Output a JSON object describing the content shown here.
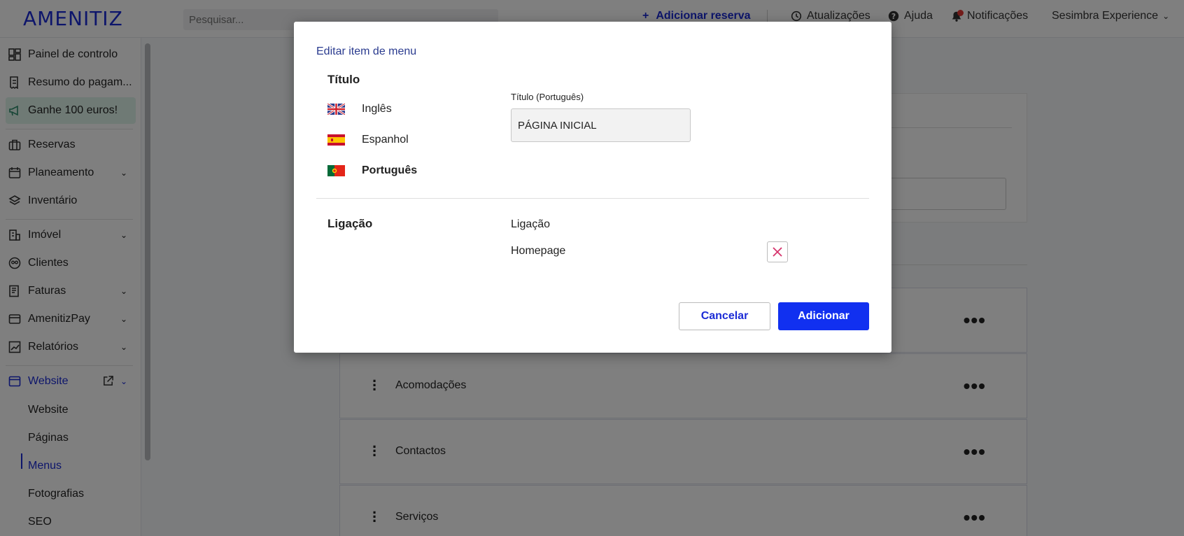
{
  "header": {
    "logo": "AMENITIZ",
    "search_placeholder": "Pesquisar...",
    "add_booking": "Adicionar reserva",
    "updates": "Atualizações",
    "help": "Ajuda",
    "notifications": "Notificações",
    "property": "Sesimbra Experience"
  },
  "sidebar": {
    "items": [
      {
        "label": "Painel de controlo"
      },
      {
        "label": "Resumo do pagam..."
      },
      {
        "label": "Ganhe 100 euros!"
      },
      {
        "label": "Reservas"
      },
      {
        "label": "Planeamento"
      },
      {
        "label": "Inventário"
      },
      {
        "label": "Imóvel"
      },
      {
        "label": "Clientes"
      },
      {
        "label": "Faturas"
      },
      {
        "label": "AmenitizPay"
      },
      {
        "label": "Relatórios"
      },
      {
        "label": "Website"
      }
    ],
    "website_sub": [
      "Website",
      "Páginas",
      "Menus",
      "Fotografias",
      "SEO"
    ]
  },
  "menu_items": [
    "Acomodações",
    "Contactos",
    "Serviços"
  ],
  "modal": {
    "heading": "Editar item de menu",
    "title_section": "Título",
    "languages": [
      "Inglês",
      "Espanhol",
      "Português"
    ],
    "title_field_label": "Título (Português)",
    "title_field_value": "PÁGINA INICIAL",
    "link_section": "Ligação",
    "link_label": "Ligação",
    "link_value": "Homepage",
    "cancel": "Cancelar",
    "add": "Adicionar"
  },
  "colors": {
    "brand": "#1b2bd6",
    "primary_button": "#1130f0",
    "promo_bg": "#def4ea",
    "remove_icon": "#d6336c"
  }
}
